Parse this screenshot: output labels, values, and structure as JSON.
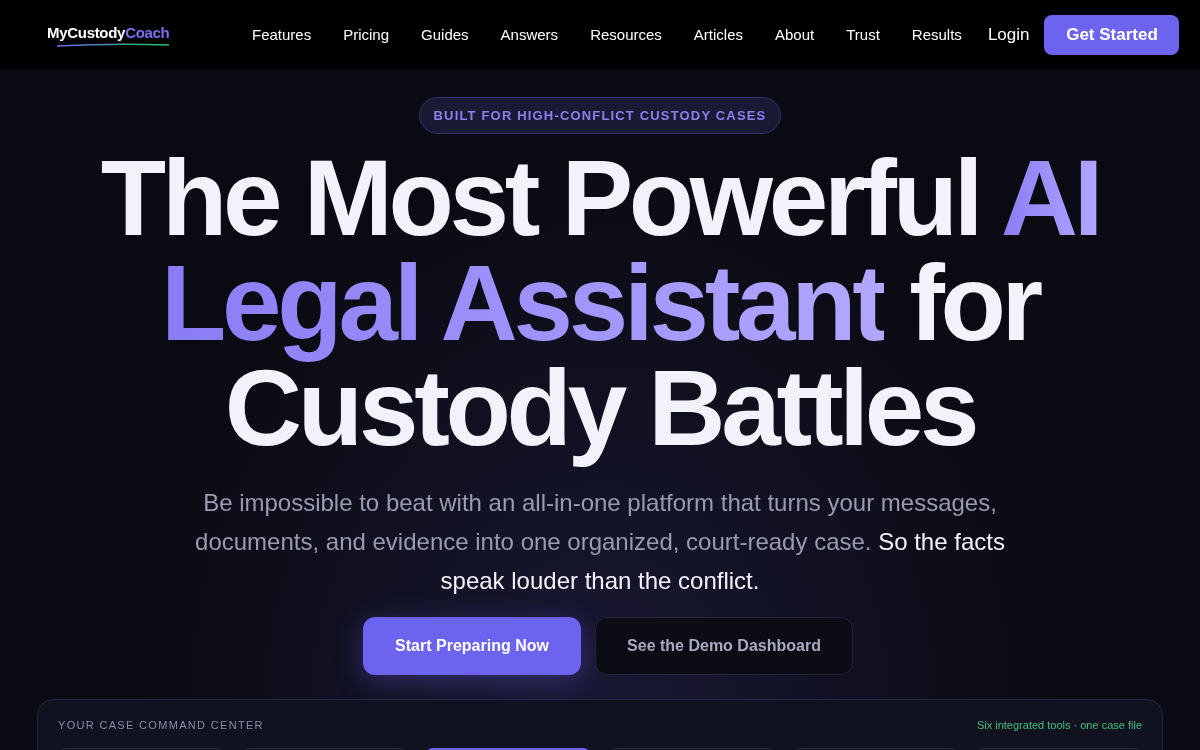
{
  "nav": {
    "logo": [
      {
        "text": "MyCustody",
        "accent": false
      },
      {
        "text": "Coach",
        "accent": true
      }
    ],
    "links": [
      "Features",
      "Pricing",
      "Guides",
      "Answers",
      "Resources",
      "Articles",
      "About",
      "Trust",
      "Results"
    ],
    "login": "Login",
    "cta": "Get Started"
  },
  "hero": {
    "badge": "BUILT FOR HIGH-CONFLICT CUSTODY CASES",
    "headline": [
      [
        {
          "text": "The Most Powerful ",
          "accent": false
        },
        {
          "text": "AI",
          "accent": true
        }
      ],
      [
        {
          "text": "Legal Assistant",
          "accent": true
        },
        {
          "text": " for",
          "accent": false
        }
      ],
      [
        {
          "text": "Custody Battles",
          "accent": false
        }
      ]
    ],
    "subtitle": [
      {
        "text": "Be impossible to beat with an all-in-one platform that turns your messages, documents, and evidence into one organized, court-ready case.",
        "emphasis": false
      },
      {
        "text": " So the facts speak louder than the conflict.",
        "emphasis": true
      }
    ],
    "buttons": [
      {
        "label": "Start Preparing Now",
        "kind": "primary"
      },
      {
        "label": "See the Demo Dashboard",
        "kind": "secondary"
      }
    ]
  },
  "command_center": {
    "title": "YOUR CASE COMMAND CENTER",
    "tagline": "Six integrated tools · one case file",
    "tools": [
      {
        "selected": false
      },
      {
        "selected": false
      },
      {
        "selected": true
      },
      {
        "selected": false
      },
      {
        "selected": false
      },
      {
        "selected": false
      }
    ]
  }
}
